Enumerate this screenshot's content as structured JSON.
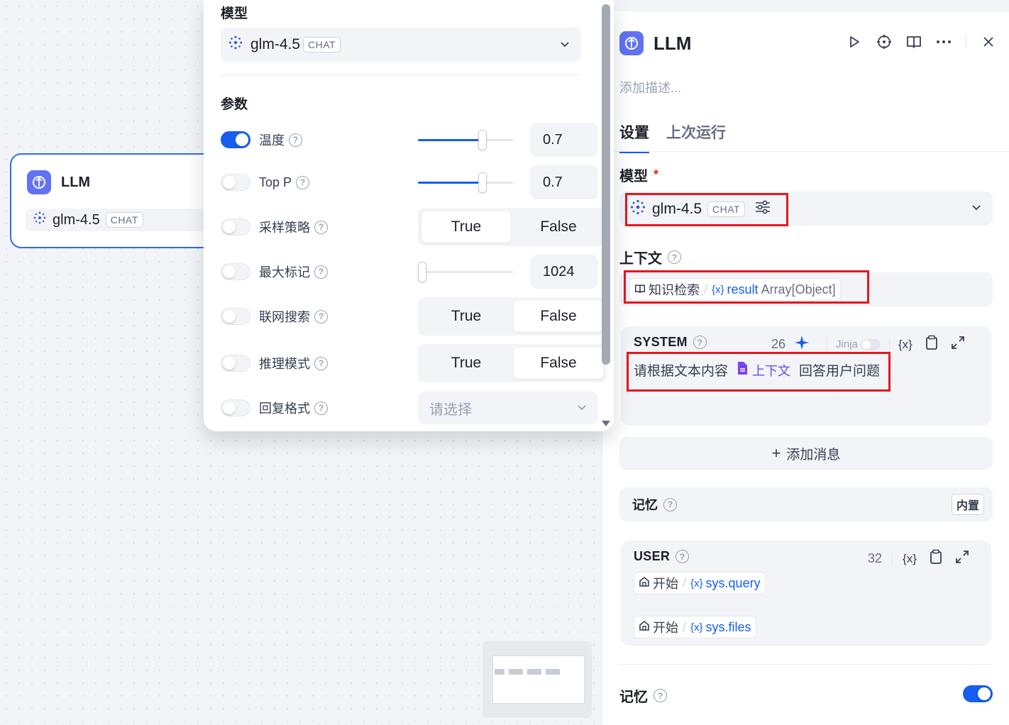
{
  "canvas_node": {
    "title": "LLM",
    "model_name": "glm-4.5",
    "model_badge": "CHAT"
  },
  "popup": {
    "model_section_title": "模型",
    "model_name": "glm-4.5",
    "model_badge": "CHAT",
    "params_section_title": "参数",
    "params": [
      {
        "label": "温度",
        "enabled": true,
        "value": "0.7",
        "level": 0.7
      },
      {
        "label": "Top P",
        "enabled": false,
        "value": "0.7",
        "level": 0.7
      },
      {
        "label": "采样策略",
        "enabled": false,
        "options": [
          "True",
          "False"
        ],
        "selected": "True"
      },
      {
        "label": "最大标记",
        "enabled": false,
        "value": "1024",
        "level": 0.0
      },
      {
        "label": "联网搜索",
        "enabled": false,
        "options": [
          "True",
          "False"
        ],
        "selected": "False"
      },
      {
        "label": "推理模式",
        "enabled": false,
        "options": [
          "True",
          "False"
        ],
        "selected": "False"
      },
      {
        "label": "回复格式",
        "enabled": false,
        "placeholder": "请选择"
      }
    ]
  },
  "panel": {
    "title": "LLM",
    "description_placeholder": "添加描述...",
    "tabs": [
      "设置",
      "上次运行"
    ],
    "active_tab": "设置",
    "model_label": "模型",
    "required_mark": "*",
    "model_name": "glm-4.5",
    "model_badge": "CHAT",
    "context_label": "上下文",
    "context_chip": {
      "source": "知识检索",
      "variable": "result",
      "type": "Array[Object]"
    },
    "system": {
      "role": "SYSTEM",
      "count": "26",
      "jinja_label": "Jinja",
      "var_icon": "{x}",
      "text_before": "请根据文本内容",
      "context_tag": "上下文",
      "text_after": "回答用户问题"
    },
    "add_message": "添加消息",
    "memory_bar": {
      "label": "记忆",
      "badge": "内置"
    },
    "user": {
      "role": "USER",
      "count": "32",
      "var_icon": "{x}",
      "vars": [
        {
          "source": "开始",
          "variable": "sys.query"
        },
        {
          "source": "开始",
          "variable": "sys.files"
        }
      ]
    },
    "memory": {
      "label": "记忆",
      "enabled": true
    }
  },
  "colors": {
    "accent": "#155eef",
    "highlight_box": "#e5161f",
    "app_icon": "#6172f3"
  }
}
